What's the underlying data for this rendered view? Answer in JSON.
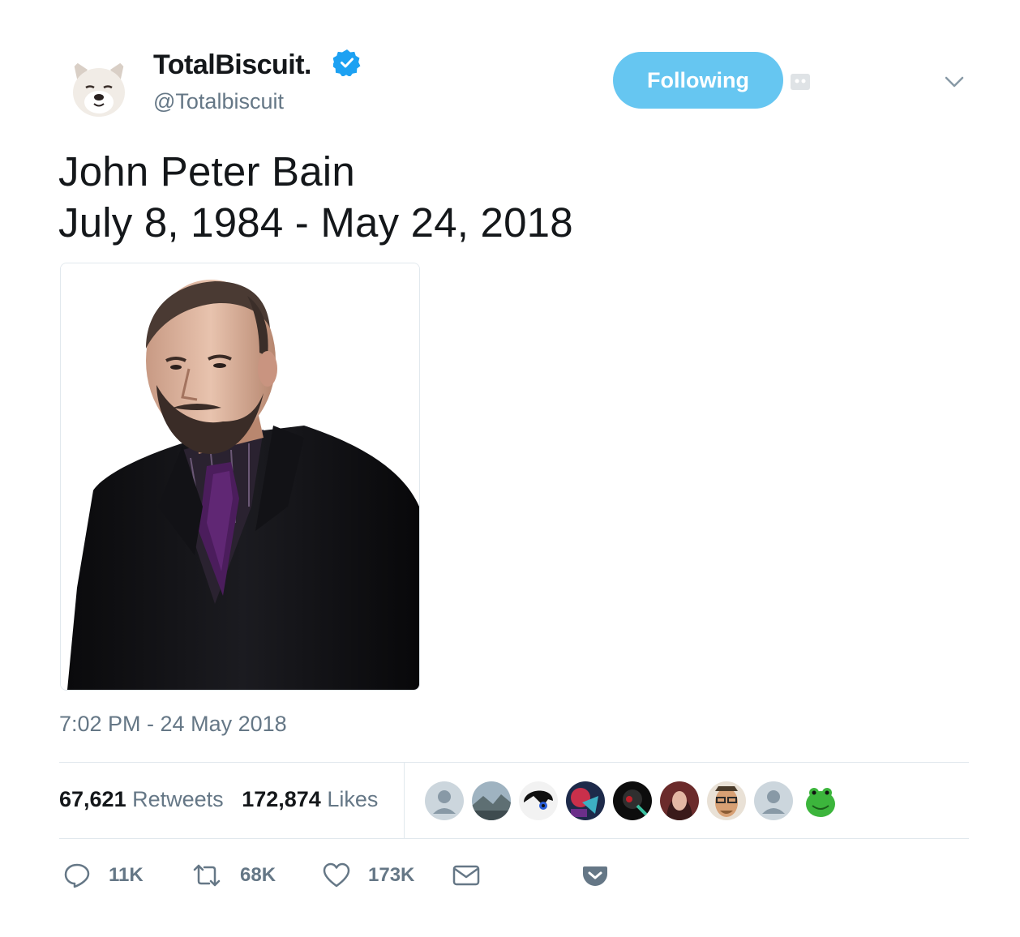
{
  "tweet": {
    "display_name": "TotalBiscuit.",
    "handle": "@Totalbiscuit",
    "follow_button_label": "Following",
    "text_lines": [
      "John Peter Bain",
      "July 8, 1984 - May 24, 2018"
    ],
    "timestamp": "7:02 PM - 24 May 2018"
  },
  "stats": {
    "retweets_count": "67,621",
    "retweets_label": "Retweets",
    "likes_count": "172,874",
    "likes_label": "Likes",
    "likers": [
      "default-avatar",
      "landscape-avatar",
      "anime-character-avatar",
      "abstract-art-avatar",
      "dark-figure-avatar",
      "woman-avatar",
      "man-with-glasses-avatar",
      "default-avatar",
      "green-frog-avatar"
    ]
  },
  "actions": {
    "reply_count": "11K",
    "retweet_count": "68K",
    "like_count": "173K"
  },
  "colors": {
    "follow_button": "#66c6f1",
    "verified_badge": "#1da1f2",
    "secondary_text": "#657786",
    "primary_text": "#14171a",
    "divider": "#e1e8ed"
  }
}
